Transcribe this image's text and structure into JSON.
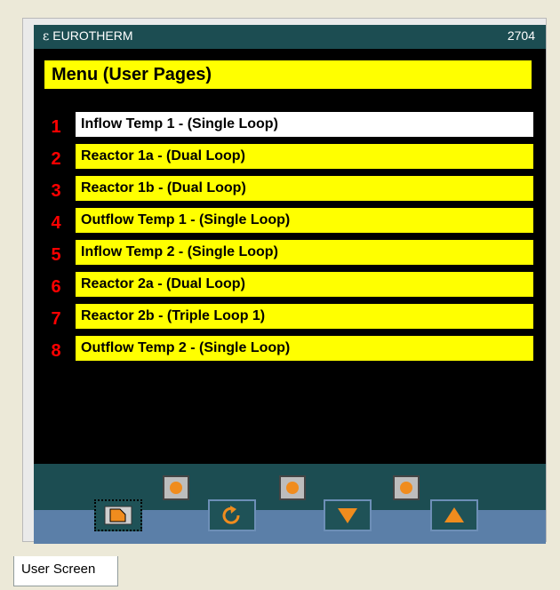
{
  "titlebar": {
    "brand": "EUROTHERM",
    "logo_glyph": "ε",
    "model": "2704"
  },
  "menu": {
    "title": "Menu (User Pages)",
    "items": [
      {
        "num": "1",
        "label": "Inflow Temp 1 - (Single Loop)",
        "selected": true
      },
      {
        "num": "2",
        "label": "Reactor 1a - (Dual Loop)"
      },
      {
        "num": "3",
        "label": "Reactor 1b - (Dual Loop)"
      },
      {
        "num": "4",
        "label": "Outflow Temp 1 - (Single Loop)"
      },
      {
        "num": "5",
        "label": "Inflow Temp 2 - (Single Loop)"
      },
      {
        "num": "6",
        "label": "Reactor 2a - (Dual Loop)"
      },
      {
        "num": "7",
        "label": "Reactor 2b - (Triple Loop 1)"
      },
      {
        "num": "8",
        "label": "Outflow Temp 2 - (Single Loop)"
      }
    ]
  },
  "softkeys": [
    "softkey-1",
    "softkey-2",
    "softkey-3"
  ],
  "navkeys": {
    "page": "page-icon",
    "scroll": "scroll-icon",
    "lower": "arrow-down-icon",
    "raise": "arrow-up-icon"
  },
  "tabs": [
    {
      "label": "User Screen"
    }
  ],
  "colors": {
    "highlight": "#ffff00",
    "selected": "#ffffff",
    "number": "#ff0000",
    "accent": "#f08c1e",
    "frame": "#1c4d52"
  }
}
